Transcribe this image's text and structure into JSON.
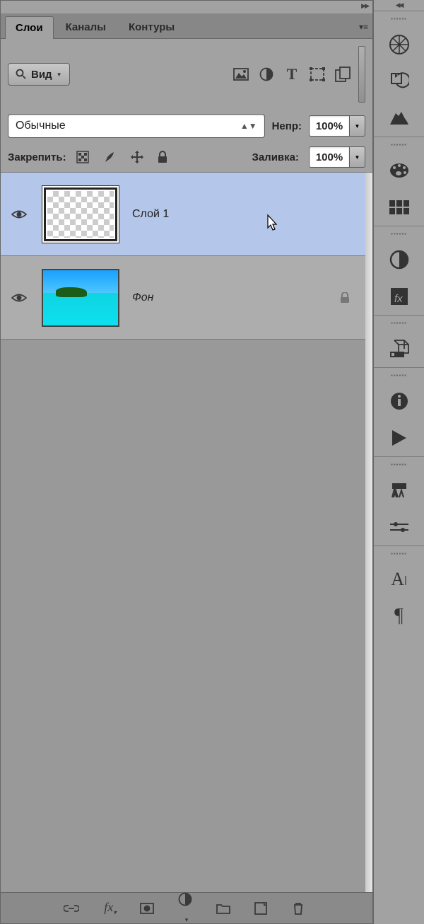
{
  "tabs": {
    "layers": "Слои",
    "channels": "Каналы",
    "paths": "Контуры"
  },
  "filter": {
    "label": "Вид"
  },
  "blend": {
    "mode": "Обычные",
    "opacity_label": "Непр:",
    "opacity_value": "100%"
  },
  "lock": {
    "label": "Закрепить:",
    "fill_label": "Заливка:",
    "fill_value": "100%"
  },
  "layers": [
    {
      "name": "Слой 1",
      "selected": true,
      "locked": false,
      "visible": true,
      "thumb": "checker"
    },
    {
      "name": "Фон",
      "selected": false,
      "locked": true,
      "visible": true,
      "thumb": "island"
    }
  ],
  "filter_icons": [
    "image-icon",
    "circle-half-icon",
    "text-icon",
    "shape-icon",
    "smartobj-icon"
  ],
  "lock_icons": [
    "lock-pixels-icon",
    "lock-brush-icon",
    "lock-move-icon",
    "lock-all-icon"
  ],
  "bottom_icons": [
    "link-icon",
    "fx-icon",
    "mask-icon",
    "adjustment-icon",
    "group-icon",
    "new-layer-icon",
    "trash-icon"
  ],
  "dock_groups": [
    [
      "navigator-icon",
      "history-icon",
      "histogram-icon"
    ],
    [
      "color-icon",
      "swatches-icon"
    ],
    [
      "adjustments2-icon",
      "styles-icon"
    ],
    [
      "3d-icon"
    ],
    [
      "info-icon",
      "play-icon"
    ],
    [
      "brushes-icon",
      "brush-settings-icon"
    ],
    [
      "character-icon",
      "paragraph-icon"
    ]
  ]
}
